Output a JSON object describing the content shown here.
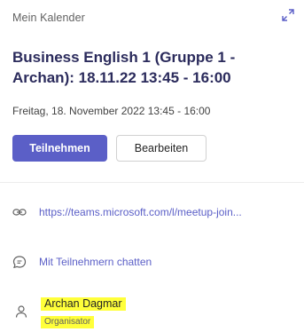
{
  "header": {
    "calendar_label": "Mein Kalender",
    "expand_icon": "expand-icon"
  },
  "meeting": {
    "title": "Business English 1 (Gruppe 1 - Archan): 18.11.22 13:45 - 16:00",
    "datetime": "Freitag, 18. November 2022 13:45 - 16:00"
  },
  "actions": {
    "join_label": "Teilnehmen",
    "edit_label": "Bearbeiten"
  },
  "details": {
    "link_icon": "link-icon",
    "link_text": "https://teams.microsoft.com/l/meetup-join...",
    "chat_icon": "chat-icon",
    "chat_text": "Mit Teilnehmern chatten"
  },
  "organizer": {
    "icon": "person-icon",
    "name": "Archan Dagmar",
    "role": "Organisator"
  },
  "colors": {
    "accent": "#5b5fc7",
    "title": "#2b2b5c",
    "highlight": "#ffff3a"
  }
}
